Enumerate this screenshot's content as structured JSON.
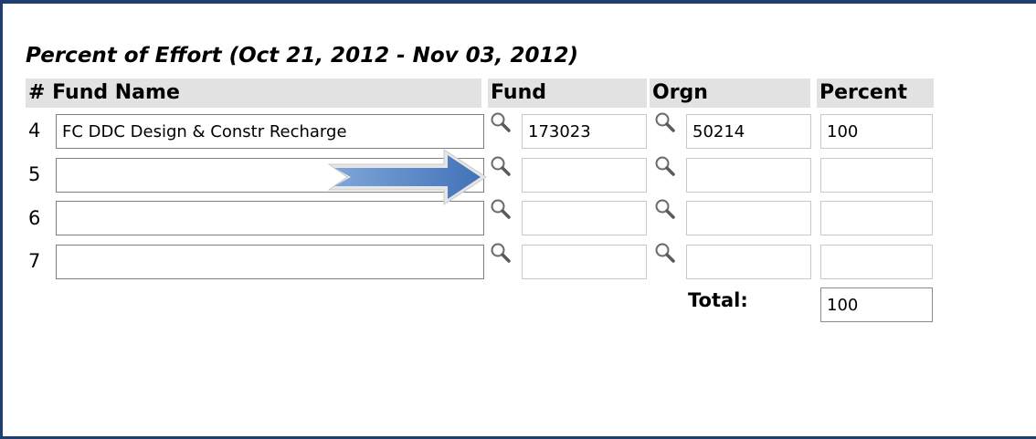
{
  "form": {
    "title": "Percent of Effort (Oct 21, 2012 - Nov 03, 2012)",
    "headers": {
      "num": "#",
      "fund_name": "Fund Name",
      "fund": "Fund",
      "orgn": "Orgn",
      "percent": "Percent"
    },
    "rows": [
      {
        "num": "4",
        "fund_name": "FC DDC Design & Constr Recharge",
        "fund": "173023",
        "orgn": "50214",
        "percent": "100"
      },
      {
        "num": "5",
        "fund_name": "",
        "fund": "",
        "orgn": "",
        "percent": ""
      },
      {
        "num": "6",
        "fund_name": "",
        "fund": "",
        "orgn": "",
        "percent": ""
      },
      {
        "num": "7",
        "fund_name": "",
        "fund": "",
        "orgn": "",
        "percent": ""
      }
    ],
    "total_label": "Total:",
    "total_value": "100"
  },
  "icons": {
    "lookup": "magnifier-icon",
    "annotation": "arrow-right"
  },
  "colors": {
    "frame_border": "#1f3f6e",
    "header_bg": "#e2e2e2",
    "arrow_fill": "#4f81bd"
  }
}
